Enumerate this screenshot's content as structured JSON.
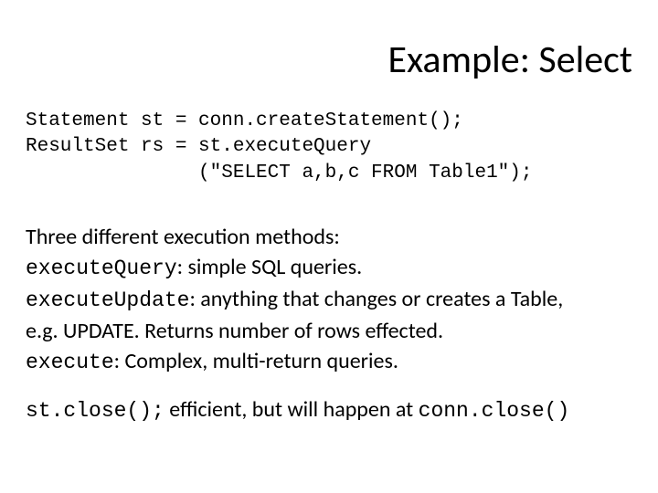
{
  "title": "Example: Select",
  "code": {
    "l1": "Statement st = conn.createStatement();",
    "l2": "ResultSet rs = st.executeQuery",
    "l3": "               (\"SELECT a,b,c FROM Table1\");"
  },
  "body": {
    "intro": "Three different execution methods:",
    "m1_name": "executeQuery",
    "m1_desc": ": simple SQL queries.",
    "m2_name": "executeUpdate",
    "m2_desc_a": ": anything that changes or creates a Table,",
    "m2_desc_b": "e.g. UPDATE. Returns number of rows effected.",
    "m3_name": "execute",
    "m3_desc": ": Complex, multi-return queries.",
    "close_code": "st.close();",
    "close_desc_a": " efficient, but will happen at ",
    "close_code2": "conn.close()"
  }
}
